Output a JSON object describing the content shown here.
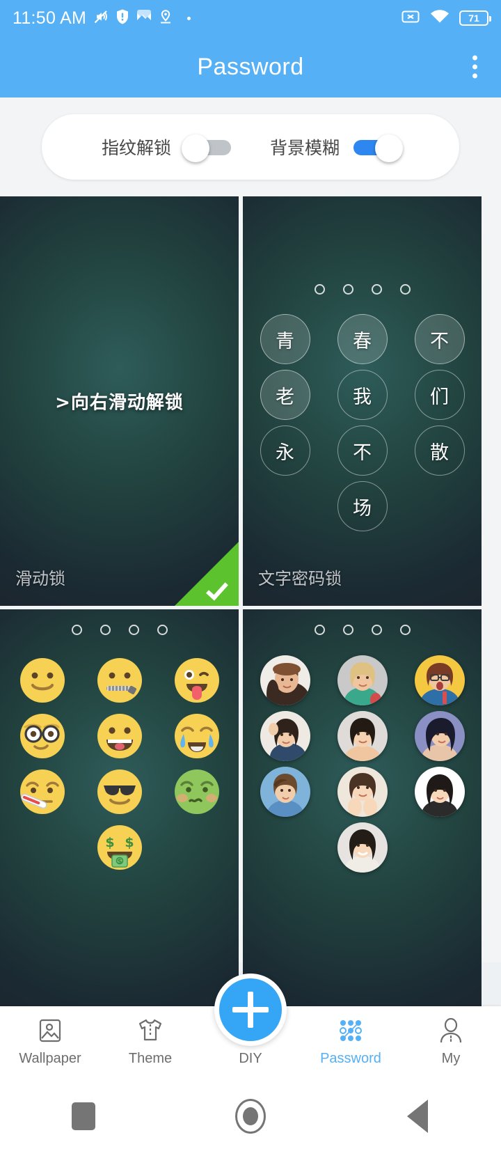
{
  "status_bar": {
    "time": "11:50 AM",
    "battery_level": "71",
    "left_icons": [
      "mute-icon",
      "shield-warning-icon",
      "maps-icon",
      "location-icon",
      "dot-icon"
    ],
    "right_icons": [
      "sim-missing-icon",
      "wifi-icon",
      "battery-icon"
    ]
  },
  "app_bar": {
    "title": "Password",
    "overflow_menu": "overflow-menu"
  },
  "toggles": [
    {
      "label": "指纹解锁",
      "name": "fingerprint-unlock",
      "on": false
    },
    {
      "label": "背景模糊",
      "name": "background-blur",
      "on": true
    }
  ],
  "colors": {
    "accent": "#55b0f5",
    "toggle_on": "#2e86f0",
    "check_green": "#5cc22e",
    "fab": "#35a6f5",
    "nav_inactive": "#6d6d6d"
  },
  "cards": [
    {
      "name": "slide-lock",
      "label": "滑动锁",
      "type": "slide",
      "slide_text": ">向右滑动解锁",
      "selected": true
    },
    {
      "name": "text-password-lock",
      "label": "文字密码锁",
      "type": "text-keypad",
      "selected": false,
      "dots": 4,
      "keys": [
        {
          "char": "青",
          "filled": true
        },
        {
          "char": "春",
          "filled": true
        },
        {
          "char": "不",
          "filled": true
        },
        {
          "char": "老",
          "filled": true
        },
        {
          "char": "我",
          "filled": false
        },
        {
          "char": "们",
          "filled": false
        },
        {
          "char": "永",
          "filled": false
        },
        {
          "char": "不",
          "filled": false
        },
        {
          "char": "散",
          "filled": false
        },
        {
          "char": "场",
          "filled": false
        }
      ]
    },
    {
      "name": "emoji-lock",
      "label": "",
      "type": "emoji-keypad",
      "selected": false,
      "dots": 4,
      "keys": [
        {
          "emoji": "slightly-smiling-face",
          "glyph": "🙂"
        },
        {
          "emoji": "zipper-mouth-face",
          "glyph": "🤐"
        },
        {
          "emoji": "winking-face-with-tongue",
          "glyph": "😜"
        },
        {
          "emoji": "nerd-face",
          "glyph": "🤓"
        },
        {
          "emoji": "grinning-face-big-eyes",
          "glyph": "😃"
        },
        {
          "emoji": "loudly-crying-face",
          "glyph": "😭"
        },
        {
          "emoji": "face-with-thermometer",
          "glyph": "🤒"
        },
        {
          "emoji": "smiling-face-with-sunglasses",
          "glyph": "😎"
        },
        {
          "emoji": "nauseated-face",
          "glyph": "🤢"
        },
        {
          "emoji": "money-mouth-face",
          "glyph": "🤑"
        }
      ]
    },
    {
      "name": "photo-lock",
      "label": "",
      "type": "photo-keypad",
      "selected": false,
      "dots": 4,
      "keys": [
        {
          "photo": "portrait-woman-hat"
        },
        {
          "photo": "portrait-blonde-woman"
        },
        {
          "photo": "portrait-woman-glasses"
        },
        {
          "photo": "portrait-woman-hand-hair"
        },
        {
          "photo": "portrait-woman-short-hair"
        },
        {
          "photo": "portrait-woman-dark-hair"
        },
        {
          "photo": "portrait-woman-blue-top"
        },
        {
          "photo": "portrait-woman-hands-chin"
        },
        {
          "photo": "portrait-woman-bangs"
        },
        {
          "photo": "portrait-woman-smiling"
        }
      ]
    }
  ],
  "bottom_nav": {
    "items": [
      {
        "label": "Wallpaper",
        "icon": "image-icon",
        "active": false
      },
      {
        "label": "Theme",
        "icon": "tshirt-icon",
        "active": false
      },
      {
        "label": "DIY",
        "icon": "plus-fab-icon",
        "active": false
      },
      {
        "label": "Password",
        "icon": "pattern-lock-icon",
        "active": true
      },
      {
        "label": "My",
        "icon": "person-icon",
        "active": false
      }
    ]
  },
  "android_nav": {
    "buttons": [
      "recents-square-icon",
      "home-circle-icon",
      "back-triangle-icon"
    ]
  }
}
